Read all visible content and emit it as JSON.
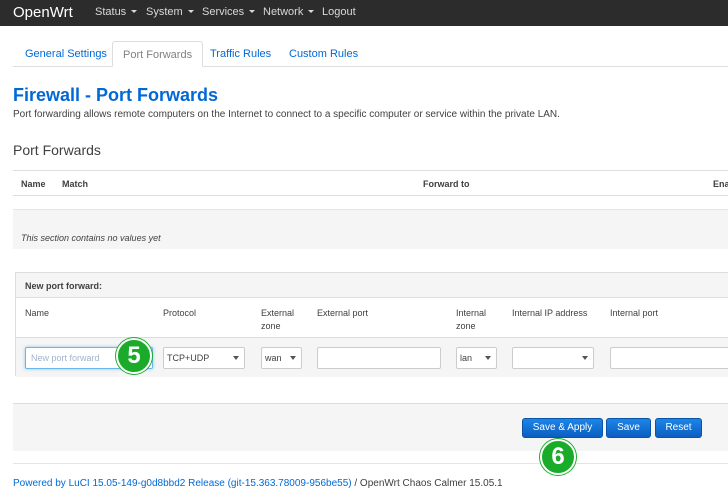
{
  "navbar": {
    "brand": "OpenWrt",
    "items": [
      {
        "label": "Status",
        "has_menu": true
      },
      {
        "label": "System",
        "has_menu": true
      },
      {
        "label": "Services",
        "has_menu": true
      },
      {
        "label": "Network",
        "has_menu": true
      },
      {
        "label": "Logout",
        "has_menu": false
      }
    ]
  },
  "tabs": [
    {
      "label": "General Settings",
      "active": false
    },
    {
      "label": "Port Forwards",
      "active": true
    },
    {
      "label": "Traffic Rules",
      "active": false
    },
    {
      "label": "Custom Rules",
      "active": false
    }
  ],
  "page": {
    "title": "Firewall - Port Forwards",
    "description": "Port forwarding allows remote computers on the Internet to connect to a specific computer or service within the private LAN."
  },
  "section": {
    "title": "Port Forwards",
    "columns": [
      "Name",
      "Match",
      "Forward to",
      "Ena"
    ],
    "empty_text": "This section contains no values yet"
  },
  "new_forward": {
    "title": "New port forward:",
    "labels": {
      "name": "Name",
      "protocol": "Protocol",
      "external_zone_1": "External",
      "external_zone_2": "zone",
      "external_port": "External port",
      "internal_zone_1": "Internal",
      "internal_zone_2": "zone",
      "internal_ip": "Internal IP address",
      "internal_port": "Internal port"
    },
    "name_placeholder": "New port forward",
    "protocol_value": "TCP+UDP",
    "external_zone_value": "wan",
    "external_port_value": "",
    "internal_zone_value": "lan",
    "internal_ip_value": "",
    "internal_port_value": ""
  },
  "actions": {
    "save_apply": "Save & Apply",
    "save": "Save",
    "reset": "Reset"
  },
  "footer": {
    "link_text": "Powered by LuCI 15.05-149-g0d8bbd2 Release (git-15.363.78009-956be55)",
    "suffix": " / OpenWrt Chaos Calmer 15.05.1"
  },
  "badges": {
    "step_a": "5",
    "step_b": "6"
  },
  "colors": {
    "navbar_bg": "#2c2c2c",
    "link_blue": "#0069d6",
    "button_blue": "#0b62c4",
    "badge_green": "#1aab2a"
  }
}
